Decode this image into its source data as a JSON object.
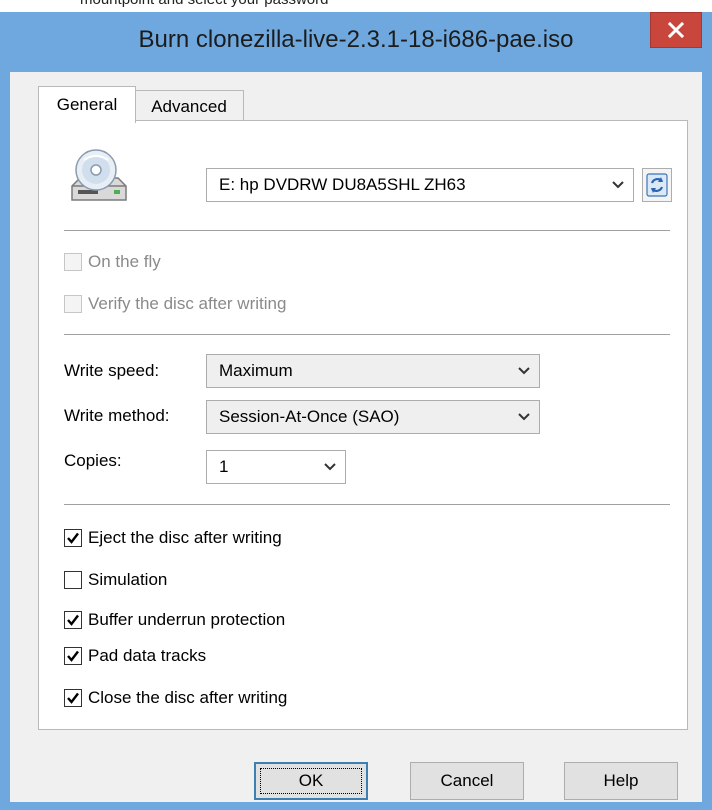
{
  "background_strip_text": "mountpoint and select your password",
  "window": {
    "title": "Burn clonezilla-live-2.3.1-18-i686-pae.iso",
    "close_glyph": "×"
  },
  "tabs": [
    {
      "label": "General",
      "active": true
    },
    {
      "label": "Advanced",
      "active": false
    }
  ],
  "drive": {
    "icon": "optical-drive-icon",
    "selected": "E: hp DVDRW  DU8A5SHL ZH63",
    "refresh_icon": "refresh-icon"
  },
  "disabled_options": [
    {
      "label": "On the fly",
      "checked": false
    },
    {
      "label": "Verify the disc after writing",
      "checked": false
    }
  ],
  "settings": {
    "write_speed_label": "Write speed:",
    "write_speed_value": "Maximum",
    "write_method_label": "Write method:",
    "write_method_value": "Session-At-Once (SAO)",
    "copies_label": "Copies:",
    "copies_value": "1"
  },
  "options": [
    {
      "label": "Eject the disc after writing",
      "checked": true
    },
    {
      "label": "Simulation",
      "checked": false
    },
    {
      "label": "Buffer underrun protection",
      "checked": true
    },
    {
      "label": "Pad data tracks",
      "checked": true
    },
    {
      "label": "Close the disc after writing",
      "checked": true
    }
  ],
  "buttons": {
    "ok": "OK",
    "cancel": "Cancel",
    "help": "Help"
  },
  "colors": {
    "window_frame": "#6ea8de",
    "close_button": "#c9463c",
    "default_button_border": "#3c7fb1"
  }
}
